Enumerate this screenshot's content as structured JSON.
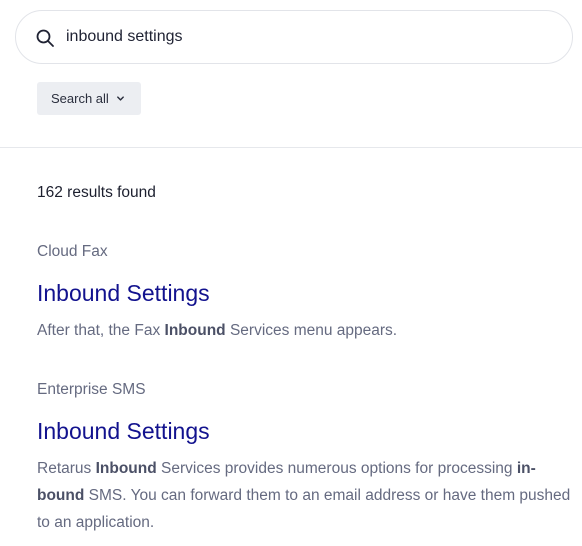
{
  "search": {
    "value": "inbound settings",
    "icon": "search-icon"
  },
  "filter": {
    "label": "Search all",
    "icon": "chevron-down-icon"
  },
  "results_summary": "162 results found",
  "results": [
    {
      "category": "Cloud Fax",
      "title": "Inbound Settings",
      "snippet": [
        {
          "text": "After that, the Fax ",
          "bold": false
        },
        {
          "text": "Inbound",
          "bold": true
        },
        {
          "text": " Services menu appears.",
          "bold": false
        }
      ]
    },
    {
      "category": "Enterprise SMS",
      "title": "Inbound Settings",
      "snippet": [
        {
          "text": "Retarus ",
          "bold": false
        },
        {
          "text": "Inbound",
          "bold": true
        },
        {
          "text": " Services provides numerous options for processing ",
          "bold": false
        },
        {
          "text": "in-bound",
          "bold": true
        },
        {
          "text": " SMS. You can forward them to an email address or have them pushed to an application.",
          "bold": false
        }
      ]
    }
  ],
  "colors": {
    "title_link": "#12128e",
    "muted_text": "#656a80",
    "filter_bg": "#eceef2"
  }
}
